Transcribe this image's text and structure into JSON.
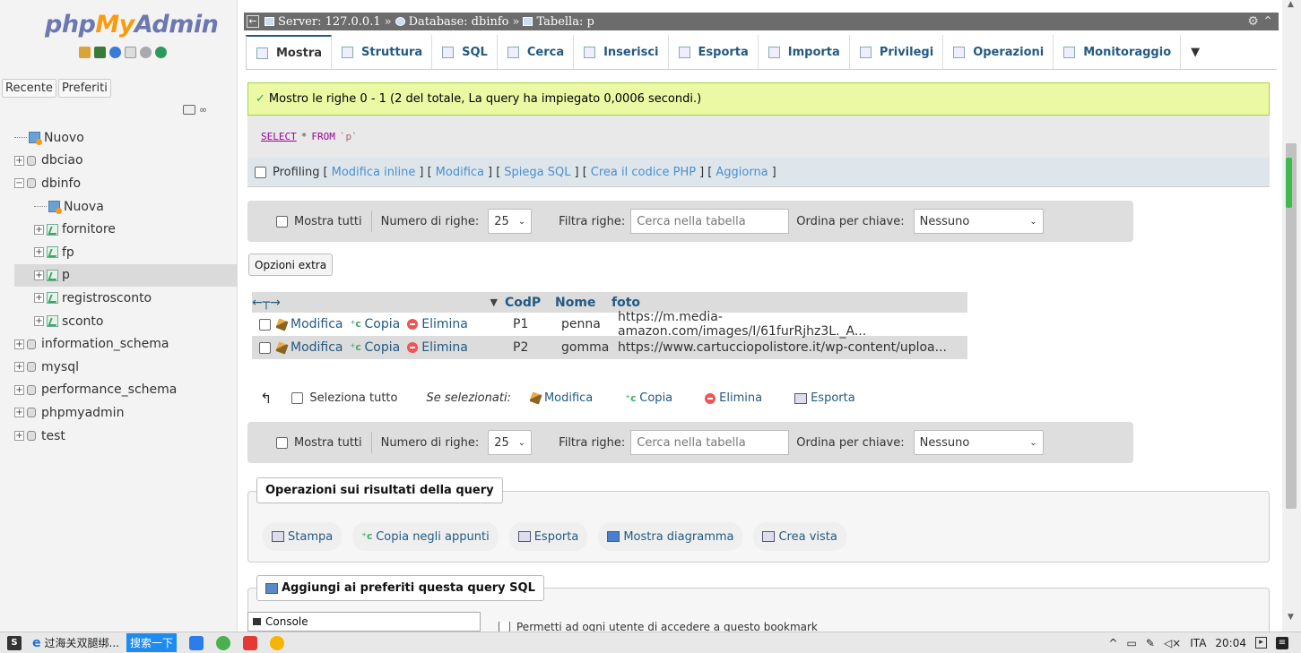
{
  "nav": {
    "logo_php": "php",
    "logo_my": "My",
    "logo_admin": "Admin",
    "tabs": [
      "Recente",
      "Preferiti"
    ],
    "tree": [
      {
        "label": "Nuovo",
        "kind": "new",
        "level": 0
      },
      {
        "label": "dbciao",
        "kind": "db",
        "level": 0
      },
      {
        "label": "dbinfo",
        "kind": "db",
        "level": 0,
        "expanded": true
      },
      {
        "label": "Nuova",
        "kind": "new",
        "level": 1
      },
      {
        "label": "fornitore",
        "kind": "table",
        "level": 1
      },
      {
        "label": "fp",
        "kind": "table",
        "level": 1
      },
      {
        "label": "p",
        "kind": "table",
        "level": 1,
        "selected": true
      },
      {
        "label": "registrosconto",
        "kind": "table",
        "level": 1
      },
      {
        "label": "sconto",
        "kind": "table",
        "level": 1
      },
      {
        "label": "information_schema",
        "kind": "db",
        "level": 0
      },
      {
        "label": "mysql",
        "kind": "db",
        "level": 0
      },
      {
        "label": "performance_schema",
        "kind": "db",
        "level": 0
      },
      {
        "label": "phpmyadmin",
        "kind": "db",
        "level": 0
      },
      {
        "label": "test",
        "kind": "db",
        "level": 0
      }
    ]
  },
  "breadcrumb": {
    "server": "Server: 127.0.0.1",
    "database": "Database: dbinfo",
    "table": "Tabella: p",
    "sep": "»"
  },
  "tabs": [
    "Mostra",
    "Struttura",
    "SQL",
    "Cerca",
    "Inserisci",
    "Esporta",
    "Importa",
    "Privilegi",
    "Operazioni",
    "Monitoraggio"
  ],
  "tabs_more": "▼",
  "success_message": "Mostro le righe 0 - 1 (2 del totale, La query ha impiegato 0,0006 secondi.)",
  "sql": {
    "kw1": "SELECT",
    "star": "*",
    "kw2": "FROM",
    "table": "`p`"
  },
  "profiling": {
    "label": "Profiling",
    "links": [
      "Modifica inline",
      "Modifica",
      "Spiega SQL",
      "Crea il codice PHP",
      "Aggiorna"
    ]
  },
  "navbar": {
    "show_all": "Mostra tutti",
    "rows_label": "Numero di righe:",
    "rows_value": "25",
    "filter_label": "Filtra righe:",
    "filter_placeholder": "Cerca nella tabella",
    "order_label": "Ordina per chiave:",
    "order_value": "Nessuno"
  },
  "extra_options": "Opzioni extra",
  "results": {
    "columns": [
      "CodP",
      "Nome",
      "foto"
    ],
    "actions": {
      "edit": "Modifica",
      "copy": "Copia",
      "delete": "Elimina"
    },
    "rows": [
      {
        "CodP": "P1",
        "Nome": "penna",
        "foto": "https://m.media-amazon.com/images/I/61furRjhz3L._A..."
      },
      {
        "CodP": "P2",
        "Nome": "gomma",
        "foto": "https://www.cartucciopolistore.it/wp-content/uploa..."
      }
    ]
  },
  "bulk": {
    "select_all": "Seleziona tutto",
    "with_selected": "Se selezionati:",
    "edit": "Modifica",
    "copy": "Copia",
    "delete": "Elimina",
    "export": "Esporta"
  },
  "query_ops": {
    "legend": "Operazioni sui risultati della query",
    "buttons": [
      "Stampa",
      "Copia negli appunti",
      "Esporta",
      "Mostra diagramma",
      "Crea vista"
    ]
  },
  "bookmark": {
    "legend": "Aggiungi ai preferiti questa query SQL",
    "permission": "Permetti ad ogni utente di accedere a questo bookmark"
  },
  "console": "Console",
  "taskbar": {
    "task1": "过海关双腿绑...",
    "search": "搜索一下",
    "lang": "ITA",
    "time": "20:04"
  },
  "colors": {
    "accent": "#235a81",
    "success_bg": "#ebf8a4",
    "logo_blue": "#6c78af",
    "logo_orange": "#f89c0e"
  }
}
